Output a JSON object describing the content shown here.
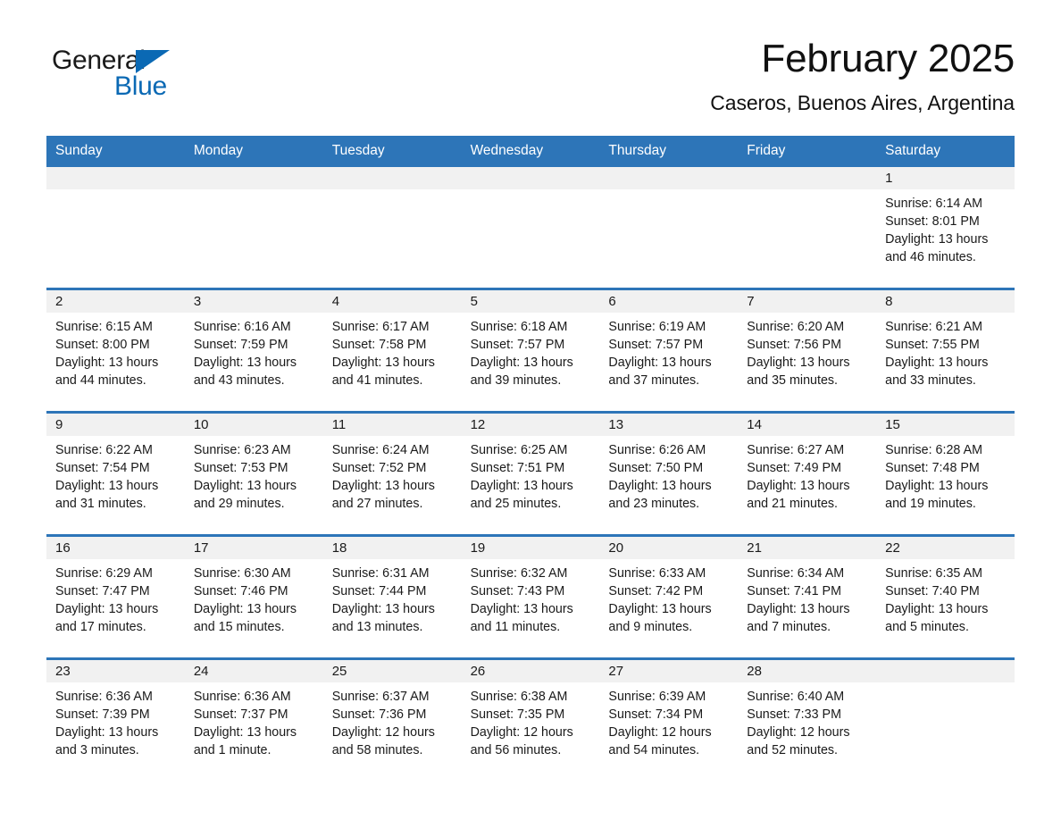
{
  "logo": {
    "word1": "General",
    "word2": "Blue",
    "accent_color": "#0b69b4"
  },
  "header": {
    "month_title": "February 2025",
    "location": "Caseros, Buenos Aires, Argentina",
    "header_bar_color": "#2d75b8"
  },
  "calendar": {
    "weekdays": [
      "Sunday",
      "Monday",
      "Tuesday",
      "Wednesday",
      "Thursday",
      "Friday",
      "Saturday"
    ],
    "weeks": [
      [
        {
          "day": "",
          "sunrise": "",
          "sunset": "",
          "daylight": "",
          "empty": true
        },
        {
          "day": "",
          "sunrise": "",
          "sunset": "",
          "daylight": "",
          "empty": true
        },
        {
          "day": "",
          "sunrise": "",
          "sunset": "",
          "daylight": "",
          "empty": true
        },
        {
          "day": "",
          "sunrise": "",
          "sunset": "",
          "daylight": "",
          "empty": true
        },
        {
          "day": "",
          "sunrise": "",
          "sunset": "",
          "daylight": "",
          "empty": true
        },
        {
          "day": "",
          "sunrise": "",
          "sunset": "",
          "daylight": "",
          "empty": true
        },
        {
          "day": "1",
          "sunrise": "Sunrise: 6:14 AM",
          "sunset": "Sunset: 8:01 PM",
          "daylight": "Daylight: 13 hours and 46 minutes."
        }
      ],
      [
        {
          "day": "2",
          "sunrise": "Sunrise: 6:15 AM",
          "sunset": "Sunset: 8:00 PM",
          "daylight": "Daylight: 13 hours and 44 minutes."
        },
        {
          "day": "3",
          "sunrise": "Sunrise: 6:16 AM",
          "sunset": "Sunset: 7:59 PM",
          "daylight": "Daylight: 13 hours and 43 minutes."
        },
        {
          "day": "4",
          "sunrise": "Sunrise: 6:17 AM",
          "sunset": "Sunset: 7:58 PM",
          "daylight": "Daylight: 13 hours and 41 minutes."
        },
        {
          "day": "5",
          "sunrise": "Sunrise: 6:18 AM",
          "sunset": "Sunset: 7:57 PM",
          "daylight": "Daylight: 13 hours and 39 minutes."
        },
        {
          "day": "6",
          "sunrise": "Sunrise: 6:19 AM",
          "sunset": "Sunset: 7:57 PM",
          "daylight": "Daylight: 13 hours and 37 minutes."
        },
        {
          "day": "7",
          "sunrise": "Sunrise: 6:20 AM",
          "sunset": "Sunset: 7:56 PM",
          "daylight": "Daylight: 13 hours and 35 minutes."
        },
        {
          "day": "8",
          "sunrise": "Sunrise: 6:21 AM",
          "sunset": "Sunset: 7:55 PM",
          "daylight": "Daylight: 13 hours and 33 minutes."
        }
      ],
      [
        {
          "day": "9",
          "sunrise": "Sunrise: 6:22 AM",
          "sunset": "Sunset: 7:54 PM",
          "daylight": "Daylight: 13 hours and 31 minutes."
        },
        {
          "day": "10",
          "sunrise": "Sunrise: 6:23 AM",
          "sunset": "Sunset: 7:53 PM",
          "daylight": "Daylight: 13 hours and 29 minutes."
        },
        {
          "day": "11",
          "sunrise": "Sunrise: 6:24 AM",
          "sunset": "Sunset: 7:52 PM",
          "daylight": "Daylight: 13 hours and 27 minutes."
        },
        {
          "day": "12",
          "sunrise": "Sunrise: 6:25 AM",
          "sunset": "Sunset: 7:51 PM",
          "daylight": "Daylight: 13 hours and 25 minutes."
        },
        {
          "day": "13",
          "sunrise": "Sunrise: 6:26 AM",
          "sunset": "Sunset: 7:50 PM",
          "daylight": "Daylight: 13 hours and 23 minutes."
        },
        {
          "day": "14",
          "sunrise": "Sunrise: 6:27 AM",
          "sunset": "Sunset: 7:49 PM",
          "daylight": "Daylight: 13 hours and 21 minutes."
        },
        {
          "day": "15",
          "sunrise": "Sunrise: 6:28 AM",
          "sunset": "Sunset: 7:48 PM",
          "daylight": "Daylight: 13 hours and 19 minutes."
        }
      ],
      [
        {
          "day": "16",
          "sunrise": "Sunrise: 6:29 AM",
          "sunset": "Sunset: 7:47 PM",
          "daylight": "Daylight: 13 hours and 17 minutes."
        },
        {
          "day": "17",
          "sunrise": "Sunrise: 6:30 AM",
          "sunset": "Sunset: 7:46 PM",
          "daylight": "Daylight: 13 hours and 15 minutes."
        },
        {
          "day": "18",
          "sunrise": "Sunrise: 6:31 AM",
          "sunset": "Sunset: 7:44 PM",
          "daylight": "Daylight: 13 hours and 13 minutes."
        },
        {
          "day": "19",
          "sunrise": "Sunrise: 6:32 AM",
          "sunset": "Sunset: 7:43 PM",
          "daylight": "Daylight: 13 hours and 11 minutes."
        },
        {
          "day": "20",
          "sunrise": "Sunrise: 6:33 AM",
          "sunset": "Sunset: 7:42 PM",
          "daylight": "Daylight: 13 hours and 9 minutes."
        },
        {
          "day": "21",
          "sunrise": "Sunrise: 6:34 AM",
          "sunset": "Sunset: 7:41 PM",
          "daylight": "Daylight: 13 hours and 7 minutes."
        },
        {
          "day": "22",
          "sunrise": "Sunrise: 6:35 AM",
          "sunset": "Sunset: 7:40 PM",
          "daylight": "Daylight: 13 hours and 5 minutes."
        }
      ],
      [
        {
          "day": "23",
          "sunrise": "Sunrise: 6:36 AM",
          "sunset": "Sunset: 7:39 PM",
          "daylight": "Daylight: 13 hours and 3 minutes."
        },
        {
          "day": "24",
          "sunrise": "Sunrise: 6:36 AM",
          "sunset": "Sunset: 7:37 PM",
          "daylight": "Daylight: 13 hours and 1 minute."
        },
        {
          "day": "25",
          "sunrise": "Sunrise: 6:37 AM",
          "sunset": "Sunset: 7:36 PM",
          "daylight": "Daylight: 12 hours and 58 minutes."
        },
        {
          "day": "26",
          "sunrise": "Sunrise: 6:38 AM",
          "sunset": "Sunset: 7:35 PM",
          "daylight": "Daylight: 12 hours and 56 minutes."
        },
        {
          "day": "27",
          "sunrise": "Sunrise: 6:39 AM",
          "sunset": "Sunset: 7:34 PM",
          "daylight": "Daylight: 12 hours and 54 minutes."
        },
        {
          "day": "28",
          "sunrise": "Sunrise: 6:40 AM",
          "sunset": "Sunset: 7:33 PM",
          "daylight": "Daylight: 12 hours and 52 minutes."
        },
        {
          "day": "",
          "sunrise": "",
          "sunset": "",
          "daylight": "",
          "empty": true
        }
      ]
    ]
  }
}
